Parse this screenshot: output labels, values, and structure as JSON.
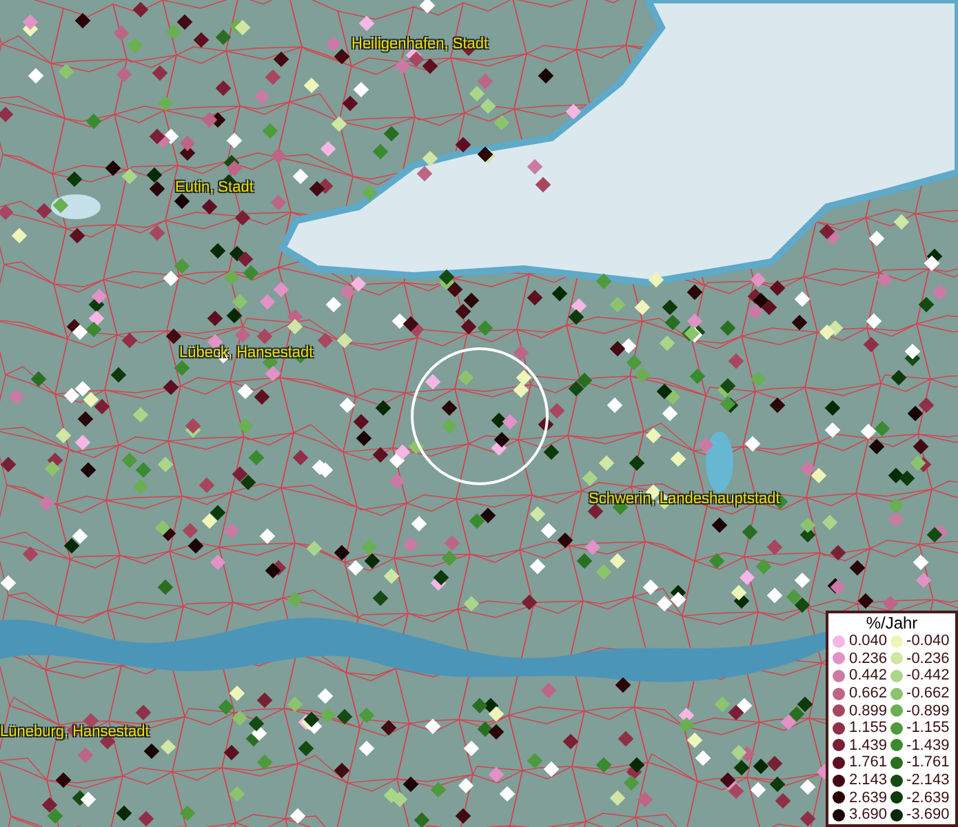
{
  "map": {
    "places": [
      {
        "name": "Heiligenhafen, Stadt",
        "kind": "town"
      },
      {
        "name": "Eutin, Stadt",
        "kind": "town"
      },
      {
        "name": "Lübeck, Hansestadt",
        "kind": "town"
      },
      {
        "name": "Schwerin, Landeshauptstadt",
        "kind": "town"
      },
      {
        "name": "Lüneburg, Hansestadt",
        "kind": "town"
      }
    ]
  },
  "legend": {
    "title": "%/Jahr",
    "columns": [
      [
        {
          "value": "0.040",
          "color": "#f7b6e6"
        },
        {
          "value": "0.236",
          "color": "#e292c6"
        },
        {
          "value": "0.442",
          "color": "#cc7aa5"
        },
        {
          "value": "0.662",
          "color": "#be6585"
        },
        {
          "value": "0.899",
          "color": "#a9465f"
        },
        {
          "value": "1.155",
          "color": "#8f3048"
        },
        {
          "value": "1.439",
          "color": "#7a2034"
        },
        {
          "value": "1.761",
          "color": "#5e1020"
        },
        {
          "value": "2.143",
          "color": "#420a12"
        },
        {
          "value": "2.639",
          "color": "#2a0508"
        },
        {
          "value": "3.690",
          "color": "#1a0304"
        }
      ],
      [
        {
          "value": "-0.040",
          "color": "#eef5b8"
        },
        {
          "value": "-0.236",
          "color": "#cfe6a4"
        },
        {
          "value": "-0.442",
          "color": "#aad68a"
        },
        {
          "value": "-0.662",
          "color": "#8cc46e"
        },
        {
          "value": "-0.899",
          "color": "#6aaf52"
        },
        {
          "value": "-1.155",
          "color": "#4e9a3c"
        },
        {
          "value": "-1.439",
          "color": "#3a8a30"
        },
        {
          "value": "-1.761",
          "color": "#2a6e22"
        },
        {
          "value": "-2.143",
          "color": "#154a12"
        },
        {
          "value": "-2.639",
          "color": "#0c3a0a"
        },
        {
          "value": "-3.690",
          "color": "#072a06"
        }
      ]
    ]
  }
}
